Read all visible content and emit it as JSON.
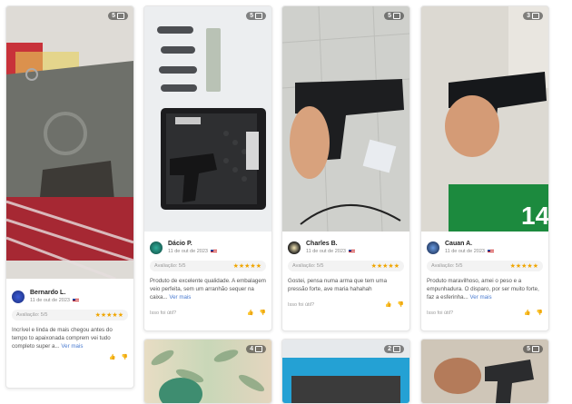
{
  "reviews": [
    {
      "badge": "5",
      "name": "Bernardo L.",
      "date": "11 de out de 2023",
      "rating_label": "Avaliação: 5/5",
      "stars": "★★★★★",
      "text": "Incrível e linda de mais chegou antes do tempo to apaixonada comprem vei tudo completo super a... Ver mais",
      "helpful": "",
      "up_icon": "thumbs-up-icon",
      "down_icon": "thumbs-down-icon"
    },
    {
      "badge": "5",
      "name": "Dácio P.",
      "date": "11 de out de 2023",
      "rating_label": "Avaliação: 5/5",
      "stars": "★★★★★",
      "text": "Produto de excelente qualidade. A embalagem veio perfeita, sem um arranhão sequer na caixa... Ver mais",
      "helpful": "Isso foi útil?"
    },
    {
      "badge": "5",
      "name": "Charles B.",
      "date": "11 de out de 2023",
      "rating_label": "Avaliação: 5/5",
      "stars": "★★★★★",
      "text": "Gostei, pensa numa arma que tem uma pressão forte, ave maria hahahah",
      "helpful": "Isso foi útil?"
    },
    {
      "badge": "3",
      "name": "Cauan A.",
      "date": "11 de out de 2023",
      "rating_label": "Avaliação: 5/5",
      "stars": "★★★★★",
      "text": "Produto maravilhoso, amei o peso e a empunhadura. O disparo, por ser muito forte, faz a esferinha... Ver mais",
      "helpful": "Isso foi útil?"
    }
  ],
  "bottom_badges": [
    "4",
    "2",
    "5"
  ],
  "ver_mais": "Ver mais"
}
